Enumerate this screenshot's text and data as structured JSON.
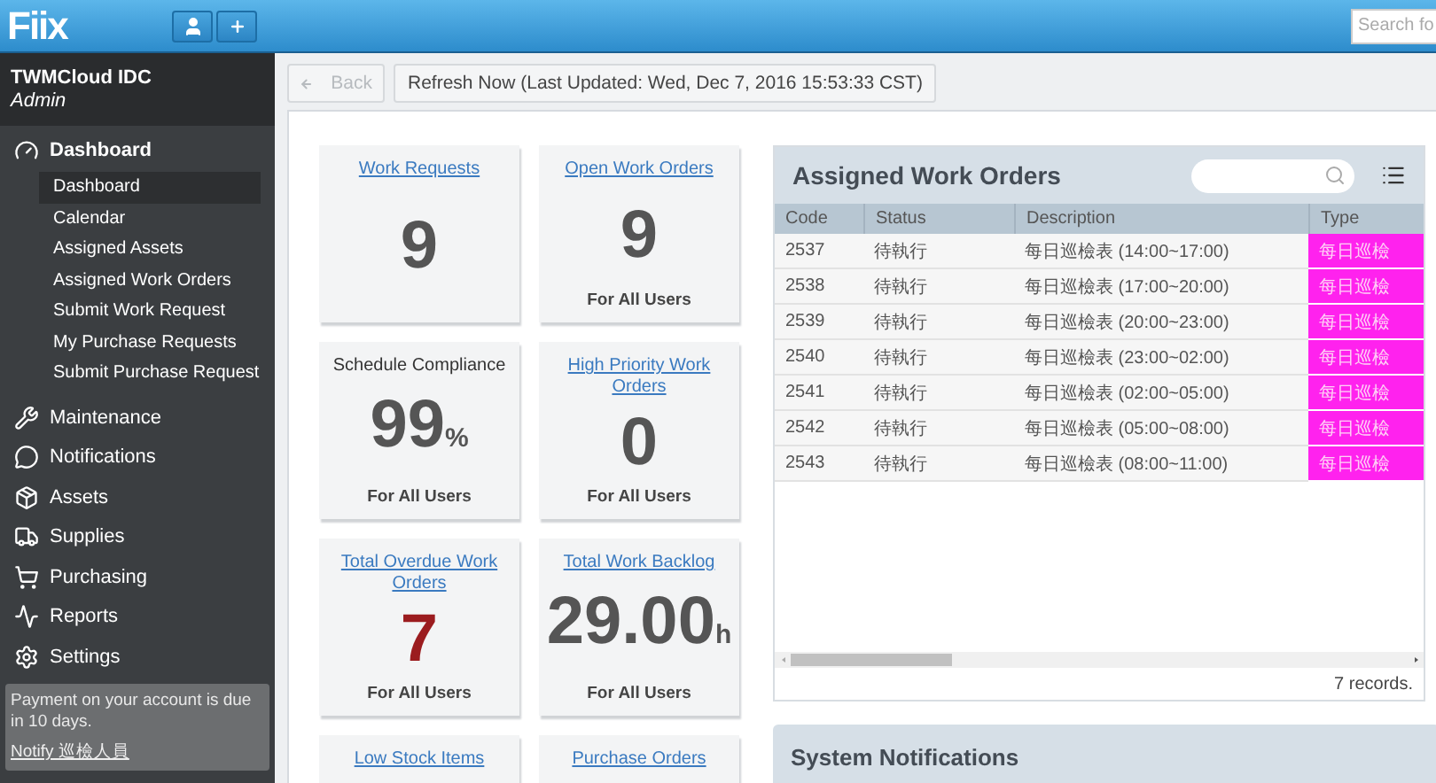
{
  "topbar": {
    "logo": "Fiix",
    "search": {
      "placeholder": "Search fo"
    }
  },
  "account": {
    "name": "TWMCloud IDC",
    "role": "Admin"
  },
  "nav": [
    {
      "label": "Dashboard",
      "children": [
        {
          "label": "Dashboard",
          "selected": true
        },
        {
          "label": "Calendar",
          "selected": false
        },
        {
          "label": "Assigned Assets",
          "selected": false
        },
        {
          "label": "Assigned Work Orders",
          "selected": false
        },
        {
          "label": "Submit Work Request",
          "selected": false
        },
        {
          "label": "My Purchase Requests",
          "selected": false
        },
        {
          "label": "Submit Purchase Request",
          "selected": false
        }
      ]
    },
    {
      "label": "Maintenance"
    },
    {
      "label": "Notifications"
    },
    {
      "label": "Assets"
    },
    {
      "label": "Supplies"
    },
    {
      "label": "Purchasing"
    },
    {
      "label": "Reports"
    },
    {
      "label": "Settings"
    }
  ],
  "notice": {
    "text": "Payment on your account is due in 10 days.",
    "link": "Notify 巡檢人員"
  },
  "toolbar": {
    "back": {
      "label": "Back",
      "disabled": true
    },
    "refresh": "Refresh Now (Last Updated: Wed, Dec 7, 2016 15:53:33 CST)"
  },
  "cards": [
    {
      "title": "Work Requests",
      "kind": "link",
      "value": "9"
    },
    {
      "title": "Open Work Orders",
      "kind": "link",
      "value": "9",
      "footer": "For All Users"
    },
    {
      "title": "Schedule Compliance",
      "kind": "plain",
      "value": "99",
      "unit": "%",
      "footer": "For All Users"
    },
    {
      "title": "High Priority Work Orders",
      "kind": "link",
      "value": "0",
      "footer": "For All Users"
    },
    {
      "title": "Total Overdue Work Orders",
      "kind": "link",
      "value": "7",
      "alert": true,
      "footer": "For All Users"
    },
    {
      "title": "Total Work Backlog",
      "kind": "link",
      "value": "29.00",
      "unit": "h",
      "footer": "For All Users"
    },
    {
      "title": "Low Stock Items",
      "kind": "link"
    },
    {
      "title": "Purchase Orders",
      "kind": "link"
    }
  ],
  "work_orders": {
    "title": "Assigned Work Orders",
    "columns": [
      "Code",
      "Status",
      "Description",
      "Type"
    ],
    "rows": [
      {
        "code": "2537",
        "status": "待執行",
        "description": "每日巡檢表 (14:00~17:00)",
        "type": "每日巡檢",
        "color": "#ff22ee"
      },
      {
        "code": "2538",
        "status": "待執行",
        "description": "每日巡檢表 (17:00~20:00)",
        "type": "每日巡檢",
        "color": "#ff22ee"
      },
      {
        "code": "2539",
        "status": "待執行",
        "description": "每日巡檢表 (20:00~23:00)",
        "type": "每日巡檢",
        "color": "#ff22ee"
      },
      {
        "code": "2540",
        "status": "待執行",
        "description": "每日巡檢表 (23:00~02:00)",
        "type": "每日巡檢",
        "color": "#ff22ee"
      },
      {
        "code": "2541",
        "status": "待執行",
        "description": "每日巡檢表 (02:00~05:00)",
        "type": "每日巡檢",
        "color": "#ff22ee"
      },
      {
        "code": "2542",
        "status": "待執行",
        "description": "每日巡檢表 (05:00~08:00)",
        "type": "每日巡檢",
        "color": "#ff22ee"
      },
      {
        "code": "2543",
        "status": "待執行",
        "description": "每日巡檢表 (08:00~11:00)",
        "type": "每日巡檢",
        "color": "#ff22ee"
      }
    ],
    "footer": "7 records."
  },
  "system_notifications": {
    "title": "System Notifications"
  }
}
